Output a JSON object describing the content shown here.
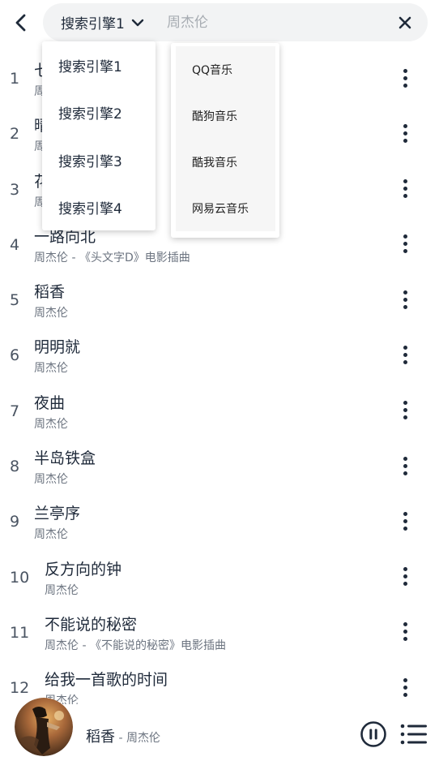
{
  "search": {
    "engine_label": "搜索引擎1",
    "query": "",
    "placeholder": "周杰伦"
  },
  "engine_menu": [
    "搜索引擎1",
    "搜索引擎2",
    "搜索引擎3",
    "搜索引擎4"
  ],
  "source_menu": [
    "QQ音乐",
    "酷狗音乐",
    "酷我音乐",
    "网易云音乐"
  ],
  "songs": [
    {
      "num": "1",
      "title": "七里香",
      "sub": "周杰伦"
    },
    {
      "num": "2",
      "title": "晴天",
      "sub": "周杰伦"
    },
    {
      "num": "3",
      "title": "花海",
      "sub": "周杰伦"
    },
    {
      "num": "4",
      "title": "一路向北",
      "sub": "周杰伦 - 《头文字D》电影插曲"
    },
    {
      "num": "5",
      "title": "稻香",
      "sub": "周杰伦"
    },
    {
      "num": "6",
      "title": "明明就",
      "sub": "周杰伦"
    },
    {
      "num": "7",
      "title": "夜曲",
      "sub": "周杰伦"
    },
    {
      "num": "8",
      "title": "半岛铁盒",
      "sub": "周杰伦"
    },
    {
      "num": "9",
      "title": "兰亭序",
      "sub": "周杰伦"
    },
    {
      "num": "10",
      "title": "反方向的钟",
      "sub": "周杰伦"
    },
    {
      "num": "11",
      "title": "不能说的秘密",
      "sub": "周杰伦 - 《不能说的秘密》电影插曲"
    },
    {
      "num": "12",
      "title": "给我一首歌的时间",
      "sub": "周杰伦"
    }
  ],
  "player": {
    "title": "稻香",
    "artist": " - 周杰伦"
  },
  "icons": {
    "back": "chevron-left-icon",
    "dropdown": "chevron-down-icon",
    "clear": "close-icon",
    "more": "more-vertical-icon",
    "play": "pause-circle-icon",
    "playlist": "playlist-icon"
  }
}
